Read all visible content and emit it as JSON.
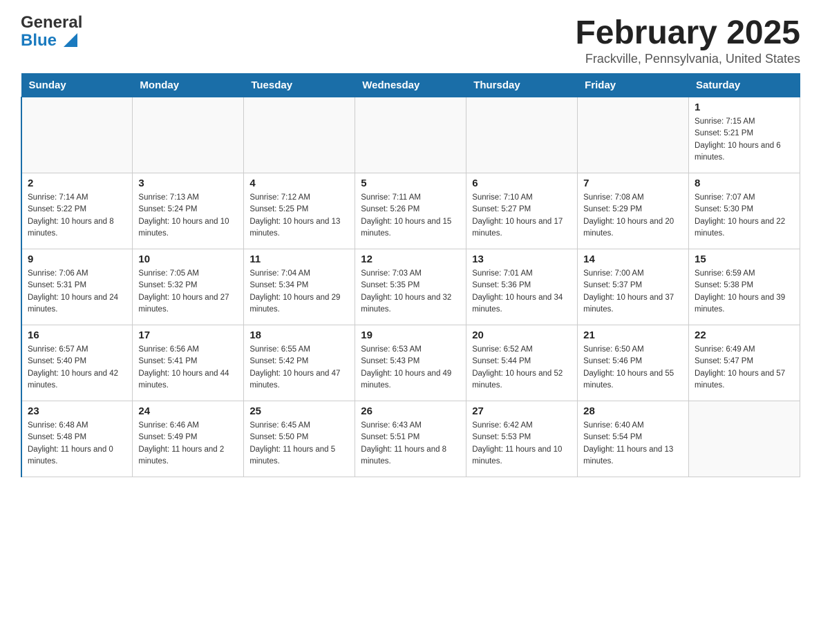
{
  "header": {
    "logo_general": "General",
    "logo_blue": "Blue",
    "month_title": "February 2025",
    "location": "Frackville, Pennsylvania, United States"
  },
  "days_of_week": [
    "Sunday",
    "Monday",
    "Tuesday",
    "Wednesday",
    "Thursday",
    "Friday",
    "Saturday"
  ],
  "weeks": [
    [
      {
        "day": "",
        "info": ""
      },
      {
        "day": "",
        "info": ""
      },
      {
        "day": "",
        "info": ""
      },
      {
        "day": "",
        "info": ""
      },
      {
        "day": "",
        "info": ""
      },
      {
        "day": "",
        "info": ""
      },
      {
        "day": "1",
        "info": "Sunrise: 7:15 AM\nSunset: 5:21 PM\nDaylight: 10 hours and 6 minutes."
      }
    ],
    [
      {
        "day": "2",
        "info": "Sunrise: 7:14 AM\nSunset: 5:22 PM\nDaylight: 10 hours and 8 minutes."
      },
      {
        "day": "3",
        "info": "Sunrise: 7:13 AM\nSunset: 5:24 PM\nDaylight: 10 hours and 10 minutes."
      },
      {
        "day": "4",
        "info": "Sunrise: 7:12 AM\nSunset: 5:25 PM\nDaylight: 10 hours and 13 minutes."
      },
      {
        "day": "5",
        "info": "Sunrise: 7:11 AM\nSunset: 5:26 PM\nDaylight: 10 hours and 15 minutes."
      },
      {
        "day": "6",
        "info": "Sunrise: 7:10 AM\nSunset: 5:27 PM\nDaylight: 10 hours and 17 minutes."
      },
      {
        "day": "7",
        "info": "Sunrise: 7:08 AM\nSunset: 5:29 PM\nDaylight: 10 hours and 20 minutes."
      },
      {
        "day": "8",
        "info": "Sunrise: 7:07 AM\nSunset: 5:30 PM\nDaylight: 10 hours and 22 minutes."
      }
    ],
    [
      {
        "day": "9",
        "info": "Sunrise: 7:06 AM\nSunset: 5:31 PM\nDaylight: 10 hours and 24 minutes."
      },
      {
        "day": "10",
        "info": "Sunrise: 7:05 AM\nSunset: 5:32 PM\nDaylight: 10 hours and 27 minutes."
      },
      {
        "day": "11",
        "info": "Sunrise: 7:04 AM\nSunset: 5:34 PM\nDaylight: 10 hours and 29 minutes."
      },
      {
        "day": "12",
        "info": "Sunrise: 7:03 AM\nSunset: 5:35 PM\nDaylight: 10 hours and 32 minutes."
      },
      {
        "day": "13",
        "info": "Sunrise: 7:01 AM\nSunset: 5:36 PM\nDaylight: 10 hours and 34 minutes."
      },
      {
        "day": "14",
        "info": "Sunrise: 7:00 AM\nSunset: 5:37 PM\nDaylight: 10 hours and 37 minutes."
      },
      {
        "day": "15",
        "info": "Sunrise: 6:59 AM\nSunset: 5:38 PM\nDaylight: 10 hours and 39 minutes."
      }
    ],
    [
      {
        "day": "16",
        "info": "Sunrise: 6:57 AM\nSunset: 5:40 PM\nDaylight: 10 hours and 42 minutes."
      },
      {
        "day": "17",
        "info": "Sunrise: 6:56 AM\nSunset: 5:41 PM\nDaylight: 10 hours and 44 minutes."
      },
      {
        "day": "18",
        "info": "Sunrise: 6:55 AM\nSunset: 5:42 PM\nDaylight: 10 hours and 47 minutes."
      },
      {
        "day": "19",
        "info": "Sunrise: 6:53 AM\nSunset: 5:43 PM\nDaylight: 10 hours and 49 minutes."
      },
      {
        "day": "20",
        "info": "Sunrise: 6:52 AM\nSunset: 5:44 PM\nDaylight: 10 hours and 52 minutes."
      },
      {
        "day": "21",
        "info": "Sunrise: 6:50 AM\nSunset: 5:46 PM\nDaylight: 10 hours and 55 minutes."
      },
      {
        "day": "22",
        "info": "Sunrise: 6:49 AM\nSunset: 5:47 PM\nDaylight: 10 hours and 57 minutes."
      }
    ],
    [
      {
        "day": "23",
        "info": "Sunrise: 6:48 AM\nSunset: 5:48 PM\nDaylight: 11 hours and 0 minutes."
      },
      {
        "day": "24",
        "info": "Sunrise: 6:46 AM\nSunset: 5:49 PM\nDaylight: 11 hours and 2 minutes."
      },
      {
        "day": "25",
        "info": "Sunrise: 6:45 AM\nSunset: 5:50 PM\nDaylight: 11 hours and 5 minutes."
      },
      {
        "day": "26",
        "info": "Sunrise: 6:43 AM\nSunset: 5:51 PM\nDaylight: 11 hours and 8 minutes."
      },
      {
        "day": "27",
        "info": "Sunrise: 6:42 AM\nSunset: 5:53 PM\nDaylight: 11 hours and 10 minutes."
      },
      {
        "day": "28",
        "info": "Sunrise: 6:40 AM\nSunset: 5:54 PM\nDaylight: 11 hours and 13 minutes."
      },
      {
        "day": "",
        "info": ""
      }
    ]
  ]
}
